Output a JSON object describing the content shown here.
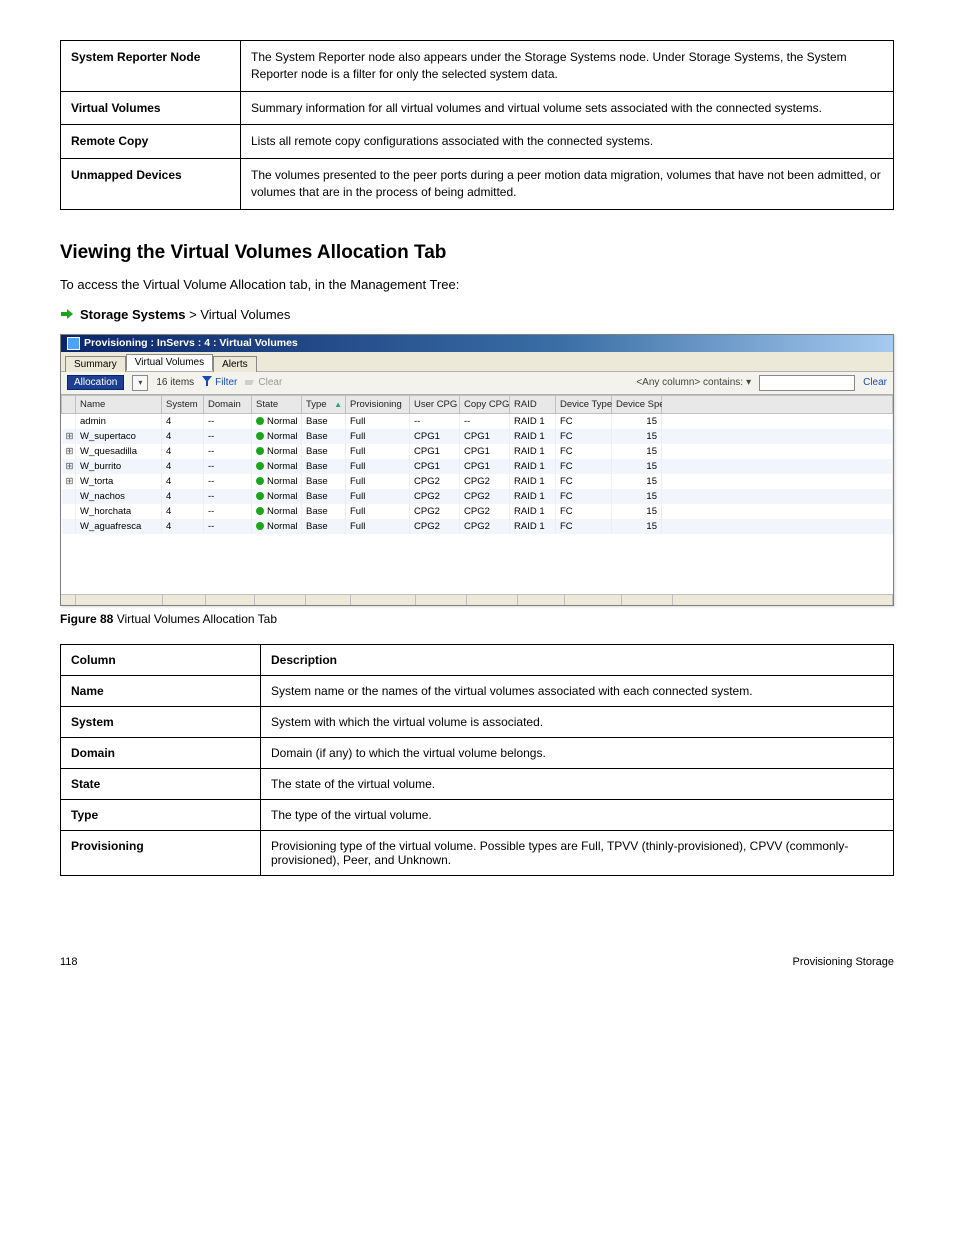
{
  "ref_table": {
    "rows": [
      {
        "col": "System Reporter Node",
        "desc": "The System Reporter node also appears under the Storage Systems node. Under Storage Systems, the System Reporter node is a filter for only the selected system data."
      },
      {
        "col": "Virtual Volumes",
        "desc": "Summary information for all virtual volumes and virtual volume sets associated with the connected systems."
      },
      {
        "col": "Remote Copy",
        "desc": "Lists all remote copy configurations associated with the connected systems."
      },
      {
        "col": "Unmapped Devices",
        "desc": "The volumes presented to the peer ports during a peer motion data migration, volumes that have not been admitted, or volumes that are in the process of being admitted."
      }
    ]
  },
  "section_title": "Viewing the Virtual Volumes Allocation Tab",
  "section_para": "To access the Virtual Volume Allocation tab, in the Management Tree:",
  "nav_label_strong": "Storage Systems",
  "nav_label_tail": " > Virtual Volumes",
  "shot": {
    "title": "Provisioning : InServs : 4 : Virtual Volumes",
    "tabs": [
      "Summary",
      "Virtual Volumes",
      "Alerts"
    ],
    "active_tab_index": 1,
    "dropdown_label": "Allocation",
    "items_count": "16 items",
    "filter_label": "Filter",
    "clear_toolbar_label": "Clear",
    "contains_label": "<Any column> contains:",
    "clear_link": "Clear",
    "columns": [
      "",
      "Name",
      "System",
      "Domain",
      "State",
      "Type",
      "Provisioning",
      "User CPG",
      "Copy CPG",
      "RAID",
      "Device Type",
      "Device Speed (K)"
    ],
    "rows": [
      {
        "exp": "",
        "name": "admin",
        "system": "4",
        "domain": "--",
        "state": "Normal",
        "type": "Base",
        "prov": "Full",
        "ucpg": "--",
        "ccpg": "--",
        "raid": "RAID 1",
        "dt": "FC",
        "ds": "15"
      },
      {
        "exp": "+",
        "name": "W_supertaco",
        "system": "4",
        "domain": "--",
        "state": "Normal",
        "type": "Base",
        "prov": "Full",
        "ucpg": "CPG1",
        "ccpg": "CPG1",
        "raid": "RAID 1",
        "dt": "FC",
        "ds": "15"
      },
      {
        "exp": "+",
        "name": "W_quesadilla",
        "system": "4",
        "domain": "--",
        "state": "Normal",
        "type": "Base",
        "prov": "Full",
        "ucpg": "CPG1",
        "ccpg": "CPG1",
        "raid": "RAID 1",
        "dt": "FC",
        "ds": "15"
      },
      {
        "exp": "+",
        "name": "W_burrito",
        "system": "4",
        "domain": "--",
        "state": "Normal",
        "type": "Base",
        "prov": "Full",
        "ucpg": "CPG1",
        "ccpg": "CPG1",
        "raid": "RAID 1",
        "dt": "FC",
        "ds": "15"
      },
      {
        "exp": "+",
        "name": "W_torta",
        "system": "4",
        "domain": "--",
        "state": "Normal",
        "type": "Base",
        "prov": "Full",
        "ucpg": "CPG2",
        "ccpg": "CPG2",
        "raid": "RAID 1",
        "dt": "FC",
        "ds": "15"
      },
      {
        "exp": "",
        "name": "W_nachos",
        "system": "4",
        "domain": "--",
        "state": "Normal",
        "type": "Base",
        "prov": "Full",
        "ucpg": "CPG2",
        "ccpg": "CPG2",
        "raid": "RAID 1",
        "dt": "FC",
        "ds": "15"
      },
      {
        "exp": "",
        "name": "W_horchata",
        "system": "4",
        "domain": "--",
        "state": "Normal",
        "type": "Base",
        "prov": "Full",
        "ucpg": "CPG2",
        "ccpg": "CPG2",
        "raid": "RAID 1",
        "dt": "FC",
        "ds": "15"
      },
      {
        "exp": "",
        "name": "W_aguafresca",
        "system": "4",
        "domain": "--",
        "state": "Normal",
        "type": "Base",
        "prov": "Full",
        "ucpg": "CPG2",
        "ccpg": "CPG2",
        "raid": "RAID 1",
        "dt": "FC",
        "ds": "15"
      }
    ]
  },
  "fig_caption_strong": "Figure 88",
  "fig_caption_tail": " Virtual Volumes Allocation Tab",
  "def_table": {
    "header_col": "Column",
    "header_desc": "Description",
    "rows": [
      {
        "col": "Name",
        "desc": "System name or the names of the virtual volumes associated with each connected system."
      },
      {
        "col": "System",
        "desc": "System with which the virtual volume is associated."
      },
      {
        "col": "Domain",
        "desc": "Domain (if any) to which the virtual volume belongs."
      },
      {
        "col": "State",
        "desc": "The state of the virtual volume."
      },
      {
        "col": "Type",
        "desc": "The type of the virtual volume."
      },
      {
        "col": "Provisioning",
        "desc": "Provisioning type of the virtual volume. Possible types are Full, TPVV (thinly-provisioned), CPVV (commonly-provisioned), Peer, and Unknown."
      }
    ]
  },
  "footer_left": "118",
  "footer_right": "Provisioning Storage"
}
